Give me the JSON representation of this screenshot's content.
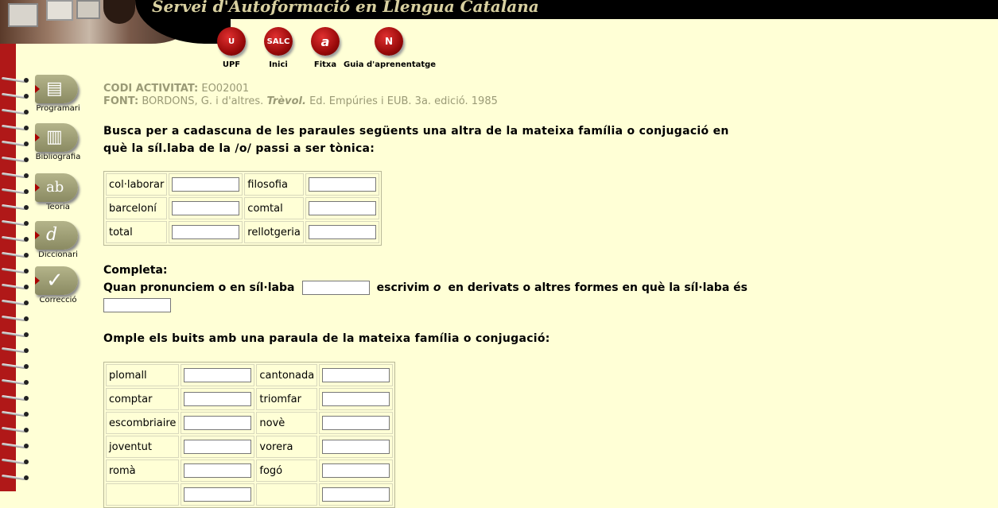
{
  "header": {
    "title": "Servei d'Autoformació en Llengua Catalana"
  },
  "top_nav": [
    {
      "label": "UPF",
      "icon": "upf-logo-icon",
      "glyph": "U"
    },
    {
      "label": "Inici",
      "icon": "salc-logo-icon",
      "glyph": "SALC"
    },
    {
      "label": "Fitxa",
      "icon": "fitxa-icon",
      "glyph": "a"
    },
    {
      "label": "Guia d'aprenentatge",
      "icon": "compass-icon",
      "glyph": "N"
    }
  ],
  "side_nav": [
    {
      "label": "Programari",
      "icon": "floppy-disk-icon",
      "glyph": "▤"
    },
    {
      "label": "Bibliografia",
      "icon": "book-icon",
      "glyph": "▥"
    },
    {
      "label": "Teoria",
      "icon": "abc-icon",
      "glyph": "ab"
    },
    {
      "label": "Diccionari",
      "icon": "dictionary-icon",
      "glyph": "d"
    },
    {
      "label": "Correcció",
      "icon": "checkmark-icon",
      "glyph": "✓"
    }
  ],
  "activity": {
    "code_label": "CODI ACTIVITAT:",
    "code_value": "EO02001",
    "source_label": "FONT:",
    "source_prefix": "BORDONS, G. i d'altres.",
    "source_title": "Trèvol.",
    "source_suffix": "Ed. Empúries i EUB. 3a. edició. 1985"
  },
  "exercise1": {
    "instruction": "Busca per a cadascuna de les paraules següents una altra de la mateixa família o conjugació en què la síl.laba de la /o/ passi a ser tònica:",
    "rows": [
      [
        "col·laborar",
        "filosofia"
      ],
      [
        "barceloní",
        "comtal"
      ],
      [
        "total",
        "rellotgeria"
      ]
    ]
  },
  "exercise2": {
    "title": "Completa:",
    "part1": "Quan pronunciem o en síl·laba",
    "part2": "escrivim",
    "part2_italic": "o",
    "part3": "en derivats o altres formes en què la síl·laba és"
  },
  "exercise3": {
    "instruction": "Omple els buits amb una paraula de la mateixa família o conjugació:",
    "rows": [
      [
        "plomall",
        "cantonada"
      ],
      [
        "comptar",
        "triomfar"
      ],
      [
        "escombriaire",
        "novè"
      ],
      [
        "joventut",
        "vorera"
      ],
      [
        "romà",
        "fogó"
      ],
      [
        "",
        ""
      ]
    ]
  }
}
